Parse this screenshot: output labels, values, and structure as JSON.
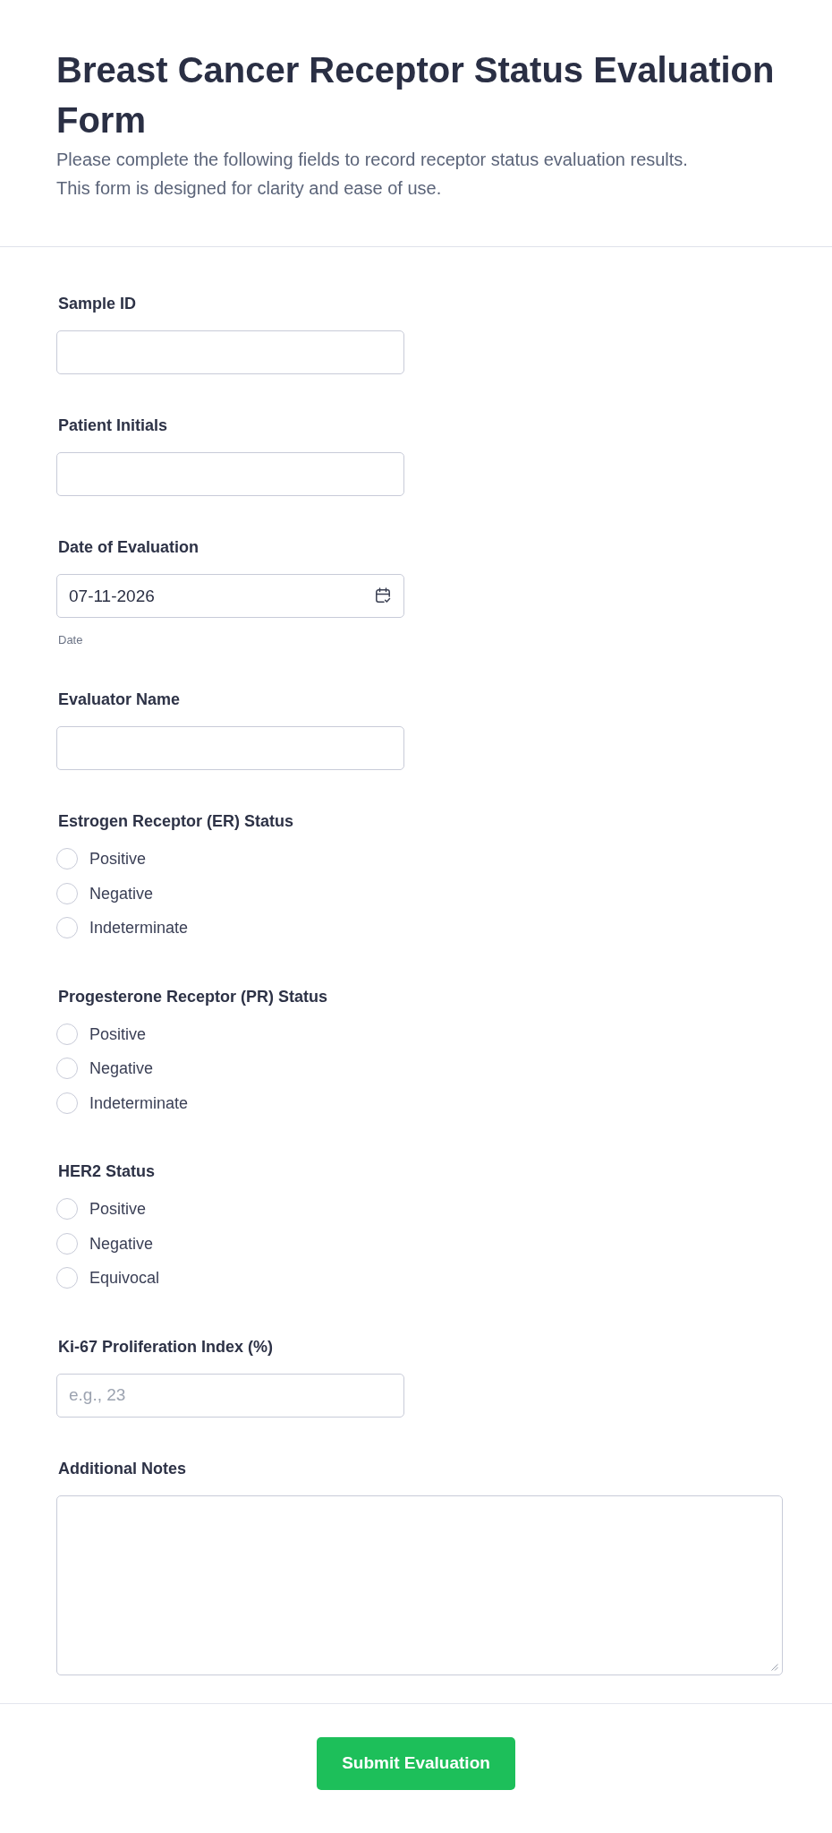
{
  "header": {
    "title": "Breast Cancer Receptor Status Evaluation Form",
    "description": "Please complete the following fields to record receptor status evaluation results. This form is designed for clarity and ease of use."
  },
  "fields": [
    {
      "kind": "text",
      "label": "Sample ID"
    },
    {
      "kind": "text",
      "label": "Patient Initials"
    },
    {
      "kind": "date",
      "label": "Date of Evaluation",
      "value": "07-11-2026",
      "hint": "Date"
    },
    {
      "kind": "text",
      "label": "Evaluator Name"
    },
    {
      "kind": "radio",
      "label": "Estrogen Receptor (ER) Status",
      "options": [
        {
          "label": "Positive",
          "selected": false
        },
        {
          "label": "Negative",
          "selected": false
        },
        {
          "label": "Indeterminate",
          "selected": false
        }
      ]
    },
    {
      "kind": "radio",
      "label": "Progesterone Receptor (PR) Status",
      "options": [
        {
          "label": "Positive",
          "selected": false
        },
        {
          "label": "Negative",
          "selected": false
        },
        {
          "label": "Indeterminate",
          "selected": false
        }
      ]
    },
    {
      "kind": "radio",
      "label": "HER2 Status",
      "options": [
        {
          "label": "Positive",
          "selected": false
        },
        {
          "label": "Negative",
          "selected": false
        },
        {
          "label": "Equivocal",
          "selected": false
        }
      ]
    },
    {
      "kind": "text",
      "label": "Ki-67 Proliferation Index (%)",
      "placeholder": "e.g., 23"
    },
    {
      "kind": "textarea",
      "label": "Additional Notes"
    }
  ],
  "submit_button": {
    "label": "Submit Evaluation"
  }
}
